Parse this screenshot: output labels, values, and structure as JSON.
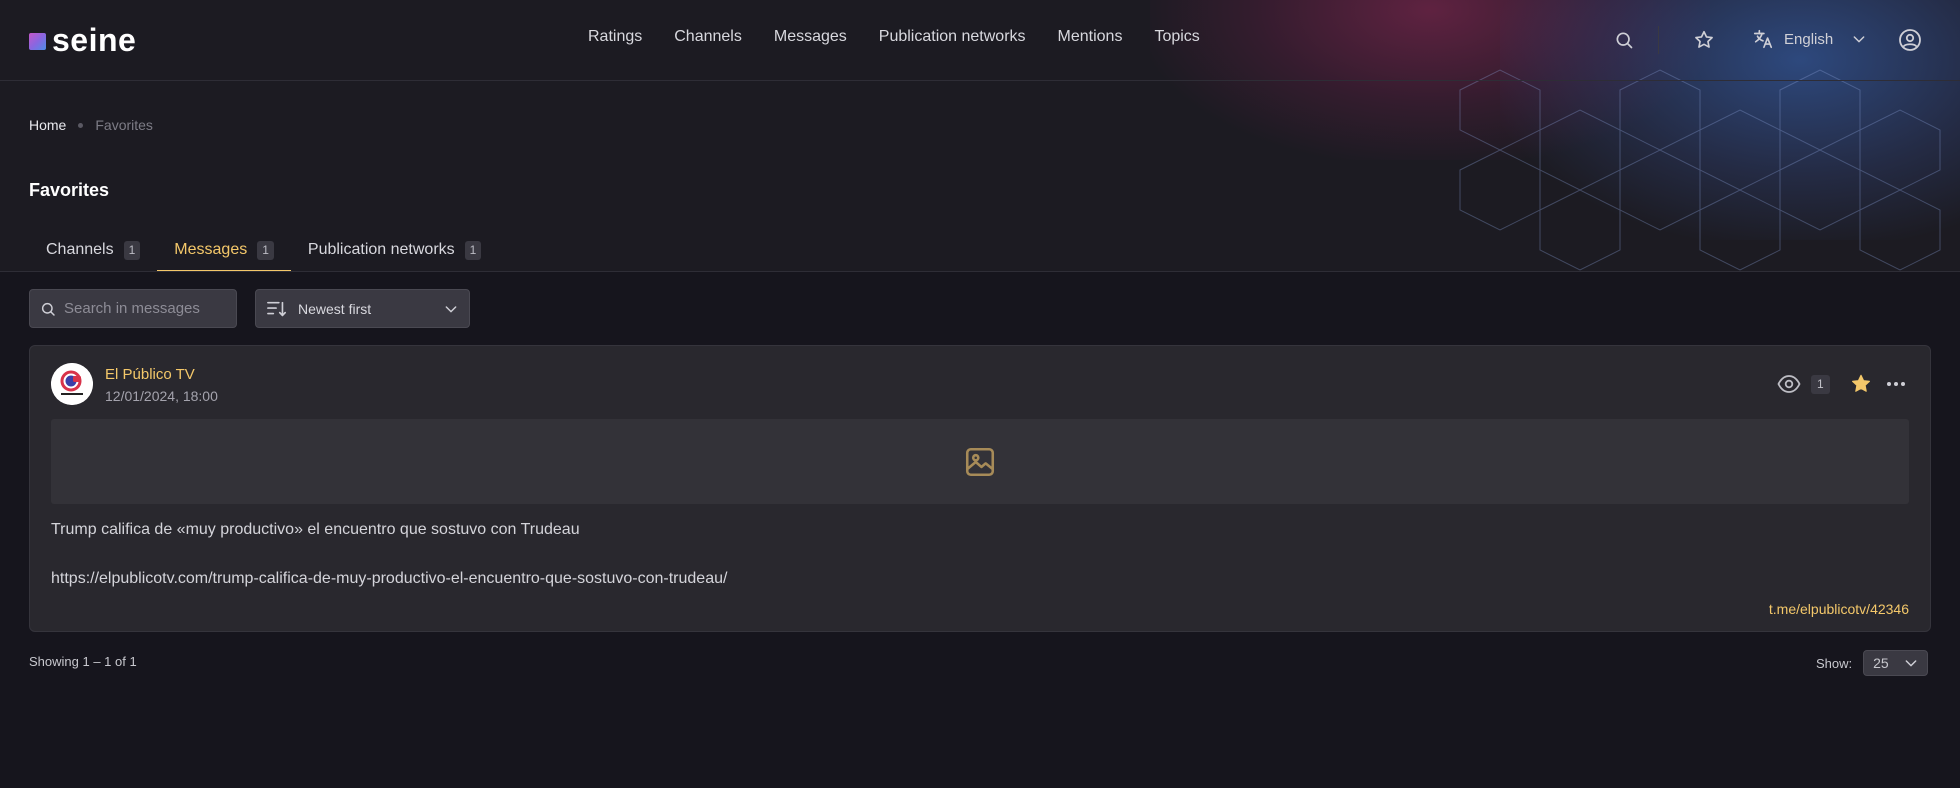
{
  "app": {
    "logo_text": "seine"
  },
  "nav": {
    "items": [
      {
        "label": "Ratings"
      },
      {
        "label": "Channels"
      },
      {
        "label": "Messages"
      },
      {
        "label": "Publication networks"
      },
      {
        "label": "Mentions"
      },
      {
        "label": "Topics"
      }
    ]
  },
  "header": {
    "language": "English",
    "icons": [
      "search-icon",
      "star-icon",
      "translate-icon",
      "chevron-down-icon",
      "user-icon"
    ]
  },
  "breadcrumb": {
    "home": "Home",
    "current": "Favorites"
  },
  "page": {
    "title": "Favorites"
  },
  "tabs": [
    {
      "label": "Channels",
      "count": "1",
      "active": false
    },
    {
      "label": "Messages",
      "count": "1",
      "active": true
    },
    {
      "label": "Publication networks",
      "count": "1",
      "active": false
    }
  ],
  "toolbar": {
    "search_placeholder": "Search in messages",
    "search_value": "",
    "sort_selected": "Newest first"
  },
  "message": {
    "channel_name": "El Público TV",
    "date": "12/01/2024, 18:00",
    "views": "1",
    "favorited": true,
    "text": "Trump califica de «muy productivo» el encuentro que sostuvo con Trudeau",
    "url": "https://elpublicotv.com/trump-califica-de-muy-productivo-el-encuentro-que-sostuvo-con-trudeau/",
    "link": "t.me/elpublicotv/42346"
  },
  "footer": {
    "showing": "Showing 1 – 1 of 1",
    "show_label": "Show:",
    "per_page": "25"
  },
  "colors": {
    "accent": "#f4c86a",
    "background": "#16151d",
    "card": "#29282e"
  }
}
